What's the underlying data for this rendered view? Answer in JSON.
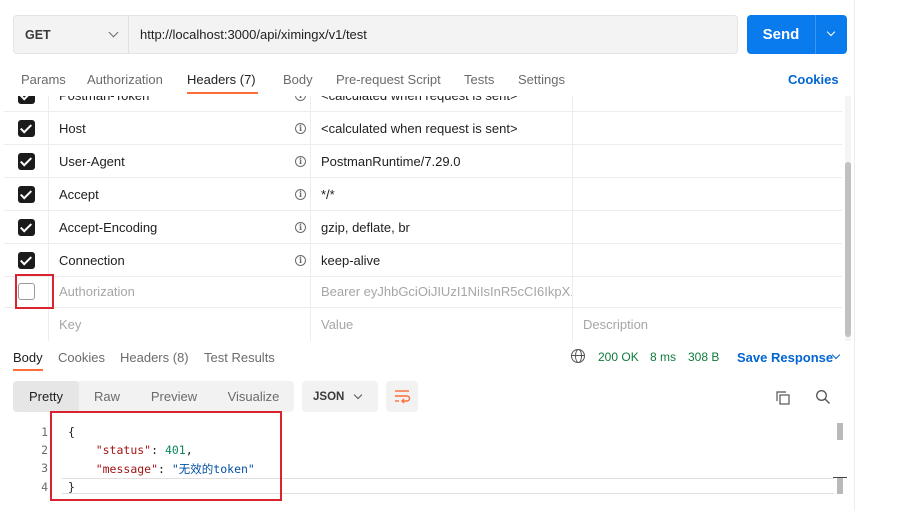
{
  "request": {
    "method": "GET",
    "url": "http://localhost:3000/api/ximingx/v1/test",
    "send_label": "Send"
  },
  "request_tabs": [
    {
      "label": "Params"
    },
    {
      "label": "Authorization"
    },
    {
      "label": "Headers (7)"
    },
    {
      "label": "Body"
    },
    {
      "label": "Pre-request Script"
    },
    {
      "label": "Tests"
    },
    {
      "label": "Settings"
    }
  ],
  "cookies_label": "Cookies",
  "headers": [
    {
      "key": "Postman-Token",
      "value": "<calculated when request is sent>",
      "checked": true
    },
    {
      "key": "Host",
      "value": "<calculated when request is sent>",
      "checked": true
    },
    {
      "key": "User-Agent",
      "value": "PostmanRuntime/7.29.0",
      "checked": true
    },
    {
      "key": "Accept",
      "value": "*/*",
      "checked": true
    },
    {
      "key": "Accept-Encoding",
      "value": "gzip, deflate, br",
      "checked": true
    },
    {
      "key": "Connection",
      "value": "keep-alive",
      "checked": true
    },
    {
      "key": "Authorization",
      "value": "Bearer eyJhbGciOiJIUzI1NiIsInR5cCI6IkpX...",
      "checked": false
    }
  ],
  "header_placeholders": {
    "key": "Key",
    "value": "Value",
    "description": "Description"
  },
  "response_tabs": [
    {
      "label": "Body"
    },
    {
      "label": "Cookies"
    },
    {
      "label": "Headers (8)"
    },
    {
      "label": "Test Results"
    }
  ],
  "response_status": {
    "status": "200 OK",
    "time": "8 ms",
    "size": "308 B"
  },
  "save_response_label": "Save Response",
  "view_modes": [
    {
      "label": "Pretty"
    },
    {
      "label": "Raw"
    },
    {
      "label": "Preview"
    },
    {
      "label": "Visualize"
    }
  ],
  "format": "JSON",
  "code": {
    "line_numbers": [
      "1",
      "2",
      "3",
      "4"
    ],
    "open_brace": "{",
    "close_brace": "}",
    "status_key": "\"status\"",
    "status_value": "401",
    "message_key": "\"message\"",
    "message_value": "\"无效的token\""
  },
  "colors": {
    "accent": "#ff6c37",
    "send_button": "#097bed",
    "link": "#0265d2",
    "status_ok": "#0f7b3c",
    "highlight_box": "#d9232e"
  }
}
